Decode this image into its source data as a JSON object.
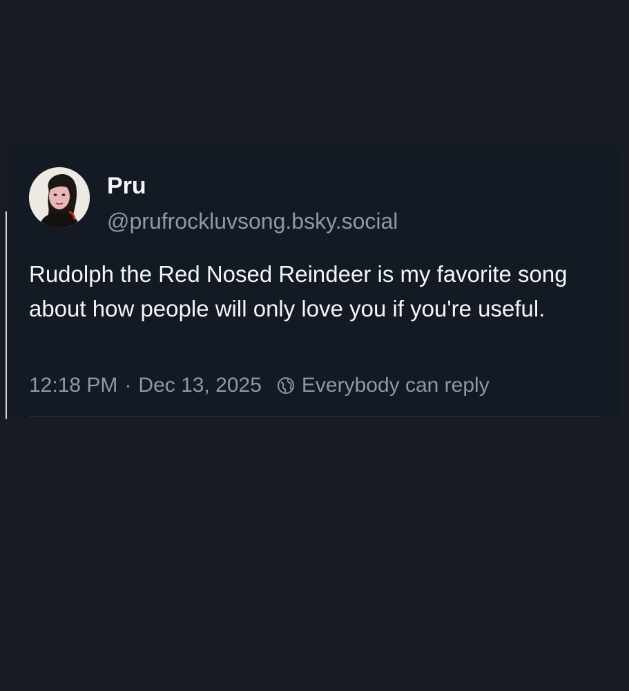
{
  "post": {
    "author": {
      "display_name": "Pru",
      "handle": "@prufrockluvsong.bsky.social"
    },
    "text": "Rudolph the Red Nosed Reindeer is my favorite song about how people will only love you if you're useful.",
    "time": "12:18 PM",
    "separator": "·",
    "date": "Dec 13, 2025",
    "reply_setting": "Everybody can reply",
    "reply_setting_icon": "globe-icon"
  },
  "colors": {
    "background": "#171c24",
    "card": "#141a24",
    "primary_text": "#f3f5f8",
    "secondary_text": "#8d99a8",
    "divider": "#243044"
  }
}
